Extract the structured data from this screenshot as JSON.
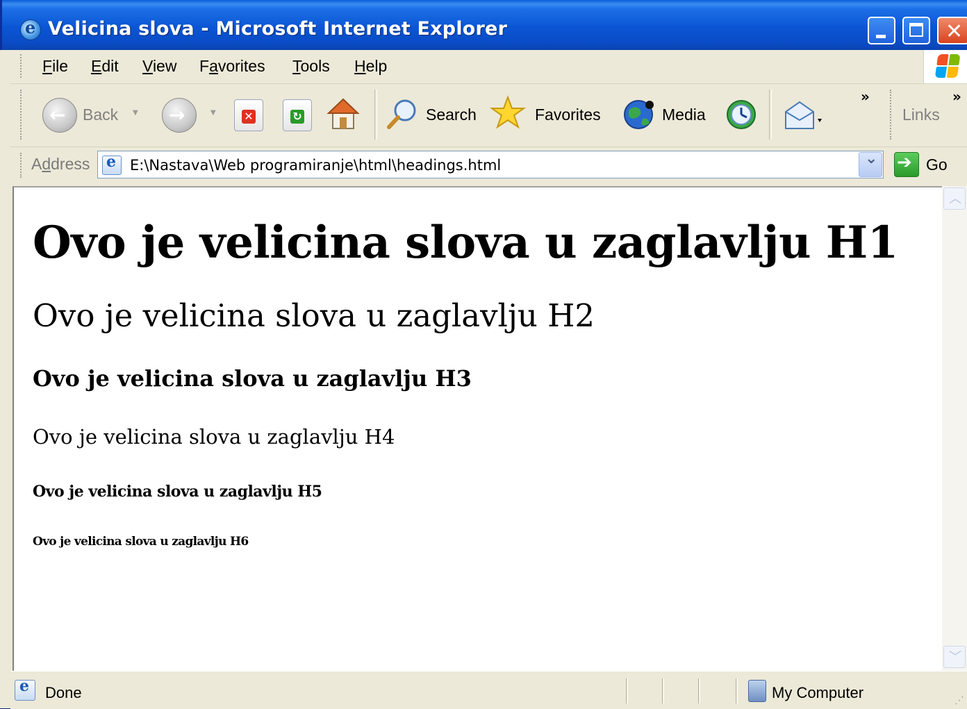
{
  "window": {
    "title": "Velicina slova - Microsoft Internet Explorer"
  },
  "menu": {
    "items": [
      {
        "label": "File",
        "accel": "F",
        "rest": "ile"
      },
      {
        "label": "Edit",
        "accel": "E",
        "rest": "dit"
      },
      {
        "label": "View",
        "accel": "V",
        "rest": "iew"
      },
      {
        "label": "Favorites",
        "pre": "F",
        "accel": "a",
        "rest": "vorites"
      },
      {
        "label": "Tools",
        "accel": "T",
        "rest": "ools"
      },
      {
        "label": "Help",
        "accel": "H",
        "rest": "elp"
      }
    ]
  },
  "toolbar": {
    "back_label": "Back",
    "search_label": "Search",
    "favorites_label": "Favorites",
    "media_label": "Media",
    "more_chevron": "»",
    "links_label": "Links",
    "links_chevron": "»"
  },
  "address": {
    "label_pre": "A",
    "label_accel": "d",
    "label_rest": "dress",
    "url": "E:\\Nastava\\Web programiranje\\html\\headings.html",
    "go_label": "Go"
  },
  "page": {
    "h1": "Ovo je velicina slova u zaglavlju H1",
    "h2": "Ovo je velicina slova u zaglavlju H2",
    "h3": "Ovo je velicina slova u zaglavlju H3",
    "h4": "Ovo je velicina slova u zaglavlju H4",
    "h5": "Ovo je velicina slova u zaglavlju H5",
    "h6": "Ovo je velicina slova u zaglavlju H6"
  },
  "status": {
    "text": "Done",
    "zone": "My Computer"
  },
  "colors": {
    "titlebar": "#0b55d4",
    "chrome": "#ece9d8",
    "close_button": "#d9431e"
  },
  "icons": [
    "ie-page-icon",
    "back-arrow-icon",
    "forward-arrow-icon",
    "stop-icon",
    "refresh-icon",
    "home-icon",
    "search-magnifier-icon",
    "favorites-star-icon",
    "media-globe-icon",
    "history-icon",
    "mail-icon",
    "windows-flag-icon",
    "go-arrow-icon",
    "my-computer-icon"
  ]
}
